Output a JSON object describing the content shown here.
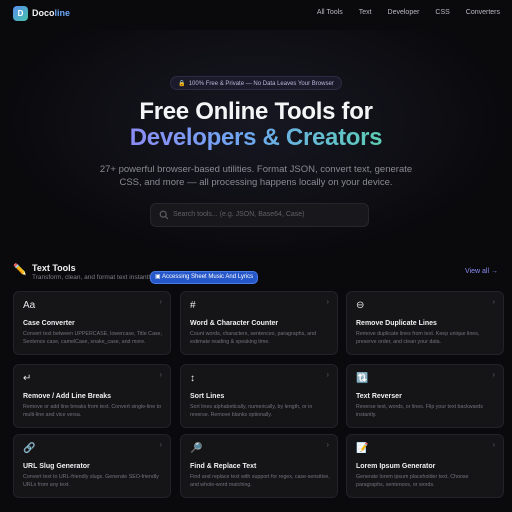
{
  "header": {
    "logo_letter": "D",
    "brand_part1": "Doco",
    "brand_part2": "line",
    "nav": [
      "All Tools",
      "Text",
      "Developer",
      "CSS",
      "Converters"
    ]
  },
  "hero": {
    "pill": "100% Free & Private — No Data Leaves Your Browser",
    "title_line1": "Free Online Tools for",
    "title_line2": "Developers & Creators",
    "subtitle": "27+ powerful browser-based utilities. Format JSON, convert text, generate CSS, and more — all processing happens locally on your device.",
    "search_placeholder": "Search tools... (e.g. JSON, Base64, Case)"
  },
  "section": {
    "icon": "✏️",
    "title": "Text Tools",
    "subtitle": "Transform, clean, and format text instantly",
    "tooltip": "Accessing Sheet Music And Lyrics",
    "view_all": "View all →"
  },
  "cards": [
    {
      "icon": "Aa",
      "icon_name": "text-case-icon",
      "title": "Case Converter",
      "desc": "Convert text between UPPERCASE, lowercase, Title Case, Sentence case, camelCase, snake_case, and more."
    },
    {
      "icon": "#",
      "icon_name": "hash-icon",
      "title": "Word & Character Counter",
      "desc": "Count words, characters, sentences, paragraphs, and estimate reading & speaking time."
    },
    {
      "icon": "⊖",
      "icon_name": "remove-circle-icon",
      "title": "Remove Duplicate Lines",
      "desc": "Remove duplicate lines from text. Keep unique lines, preserve order, and clean your data."
    },
    {
      "icon": "↵",
      "icon_name": "return-arrow-icon",
      "title": "Remove / Add Line Breaks",
      "desc": "Remove or add line breaks from text. Convert single-line to multi-line and vice versa."
    },
    {
      "icon": "↕",
      "icon_name": "sort-arrows-icon",
      "title": "Sort Lines",
      "desc": "Sort lines alphabetically, numerically, by length, or in reverse. Remove blanks optionally."
    },
    {
      "icon": "🔃",
      "icon_name": "reverse-arrows-icon",
      "title": "Text Reverser",
      "desc": "Reverse text, words, or lines. Flip your text backwards instantly."
    },
    {
      "icon": "🔗",
      "icon_name": "link-icon",
      "title": "URL Slug Generator",
      "desc": "Convert text to URL-friendly slugs. Generate SEO-friendly URLs from any text."
    },
    {
      "icon": "🔎",
      "icon_name": "magnifier-icon",
      "title": "Find & Replace Text",
      "desc": "Find and replace text with support for regex, case-sensitive, and whole-word matching."
    },
    {
      "icon": "📝",
      "icon_name": "memo-icon",
      "title": "Lorem Ipsum Generator",
      "desc": "Generate lorem ipsum placeholder text. Choose paragraphs, sentences, or words."
    }
  ],
  "card_arrow": "›"
}
